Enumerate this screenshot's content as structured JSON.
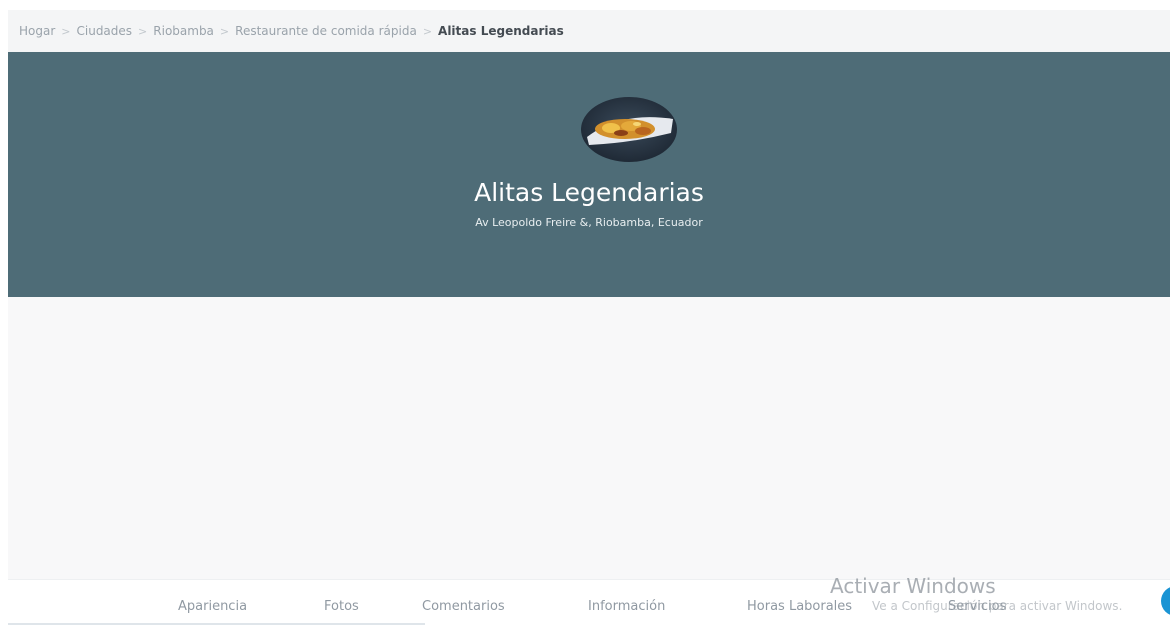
{
  "breadcrumb": {
    "items": [
      "Hogar",
      "Ciudades",
      "Riobamba",
      "Restaurante de comida rápida"
    ],
    "current": "Alitas Legendarias",
    "separator": ">"
  },
  "hero": {
    "title": "Alitas Legendarias",
    "address": "Av Leopoldo Freire &, Riobamba, Ecuador",
    "avatar_icon": "food-photo-avatar",
    "background_color": "#4e6c77"
  },
  "tabs": [
    {
      "label": "Apariencia",
      "active": true
    },
    {
      "label": "Fotos"
    },
    {
      "label": "Comentarios"
    },
    {
      "label": "Información"
    },
    {
      "label": "Horas Laborales"
    },
    {
      "label": "Servicios"
    }
  ],
  "watermark": {
    "title": "Activar Windows",
    "subtitle": "Ve a Configuración para activar Windows."
  },
  "fab": {
    "icon": "chat-bubble-icon",
    "color": "#1a94d4"
  }
}
